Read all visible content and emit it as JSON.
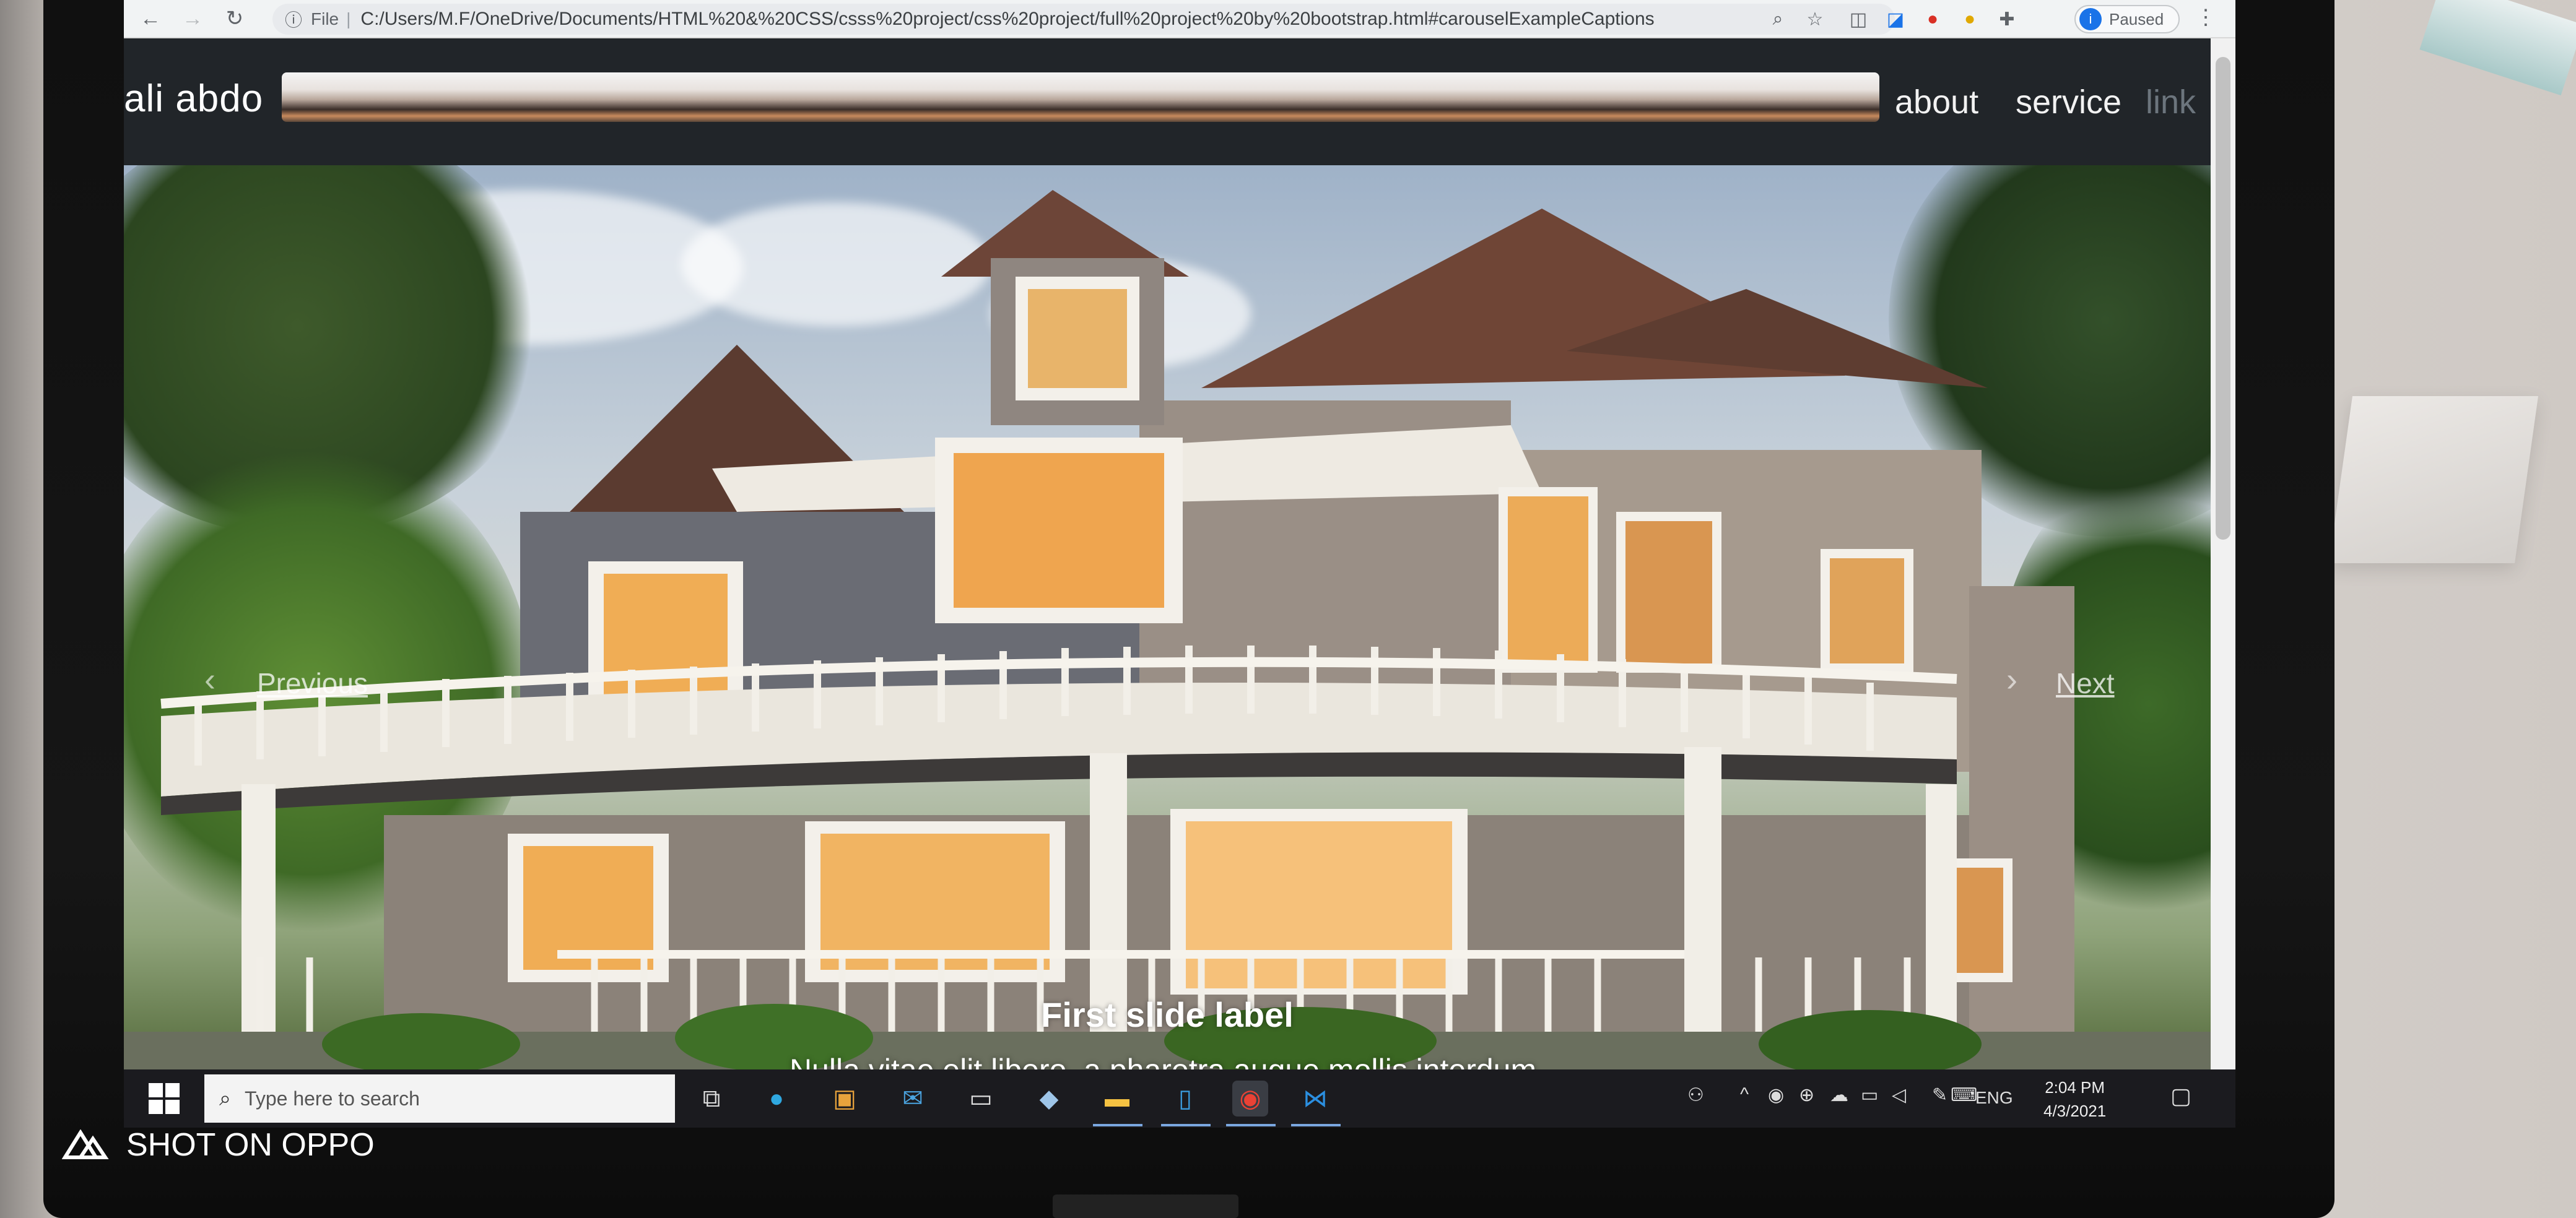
{
  "browser": {
    "url_prefix": "File",
    "url": "C:/Users/M.F/OneDrive/Documents/HTML%20&%20CSS/csss%20project/css%20project/full%20project%20by%20bootstrap.html#carouselExampleCaptions",
    "profile_initial": "i",
    "status": "Paused"
  },
  "navbar": {
    "brand": "ali abdo",
    "links": [
      "about",
      "service",
      "link"
    ]
  },
  "carousel": {
    "prev_label": "Previous",
    "next_label": "Next",
    "caption_title": "First slide label",
    "caption_text": "Nulla vitae elit libero, a pharetra augue mollis interdum."
  },
  "taskbar": {
    "search_placeholder": "Type here to search",
    "language": "ENG",
    "time": "2:04 PM",
    "date": "4/3/2021"
  },
  "watermark": {
    "text": "SHOT ON OPPO"
  },
  "colors": {
    "navbar_bg": "#212529",
    "taskbar_bg": "#1b1b1f",
    "disabled_link": "#6c757d"
  }
}
